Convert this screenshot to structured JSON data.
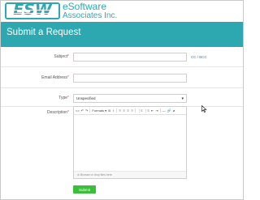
{
  "brand": {
    "logo_text": "ESW",
    "name": "eSoftware",
    "sub": "Associates Inc."
  },
  "colors": {
    "brand": "#2da8b1",
    "link": "#2a7bd0",
    "submit": "#3bbf3b",
    "required": "#d9534f"
  },
  "header": {
    "title": "Submit a Request"
  },
  "form": {
    "subject": {
      "label": "Subject",
      "required_mark": "*",
      "value": "",
      "cc_link": "CC / BCC"
    },
    "email": {
      "label": "Email Address",
      "required_mark": "*",
      "value": ""
    },
    "type": {
      "label": "Type",
      "required_mark": "*",
      "selected": "Unspecified"
    },
    "description": {
      "label": "Description",
      "required_mark": "*",
      "toolbar": {
        "items": [
          "<>",
          "↶",
          "↷",
          "Formats ▾",
          "B",
          "I",
          "≡",
          "≡",
          "≡",
          "≡",
          "⋮≡",
          "⋮≡",
          "⇤",
          "⇥",
          "—",
          "🔗",
          "⌀"
        ],
        "icons": [
          "source-code-icon",
          "undo-icon",
          "redo-icon",
          "formats-dropdown",
          "bold-icon",
          "italic-icon",
          "align-left-icon",
          "align-center-icon",
          "align-right-icon",
          "align-justify-icon",
          "bullet-list-icon",
          "numbered-list-icon",
          "outdent-icon",
          "indent-icon",
          "horizontal-rule-icon",
          "link-icon",
          "unlink-icon"
        ]
      },
      "attach_text": "Browse or drop files here"
    },
    "submit_label": "Submit"
  }
}
